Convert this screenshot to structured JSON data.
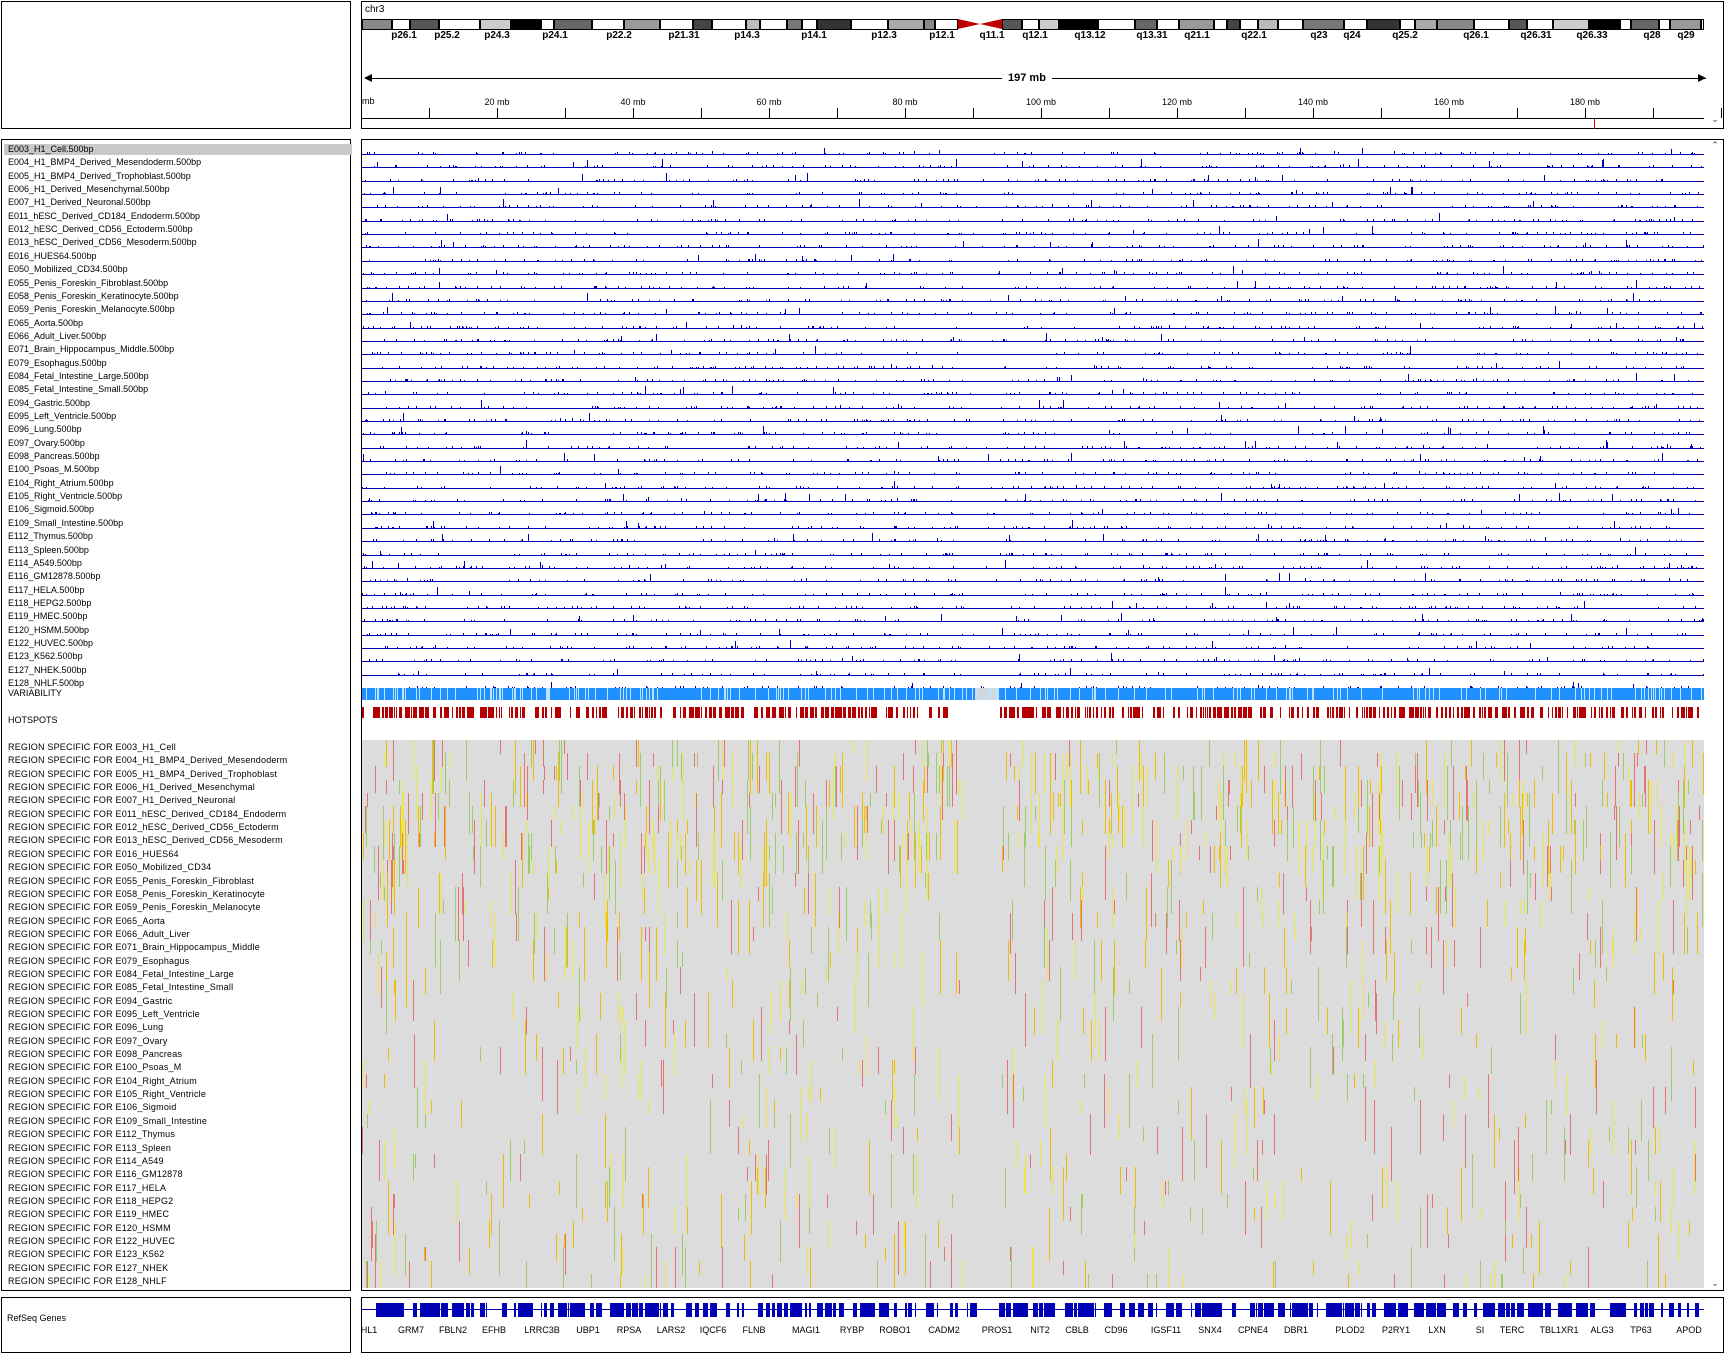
{
  "chromosome": "chr3",
  "span_label": "197 mb",
  "ruler_start_label": "mb",
  "ruler_labels": [
    "20 mb",
    "40 mb",
    "60 mb",
    "80 mb",
    "100 mb",
    "120 mb",
    "140 mb",
    "160 mb",
    "180 mb"
  ],
  "cytobands": [
    "p26.1",
    "p25.2",
    "p24.3",
    "p24.1",
    "p22.2",
    "p21.31",
    "p14.3",
    "p14.1",
    "p12.3",
    "p12.1",
    "q11.1",
    "q12.1",
    "q13.12",
    "q13.31",
    "q21.1",
    "q22.1",
    "q23",
    "q24",
    "q25.2",
    "q26.1",
    "q26.31",
    "q26.33",
    "q28",
    "q29"
  ],
  "tracks": [
    "E003_H1_Cell.500bp",
    "E004_H1_BMP4_Derived_Mesendoderm.500bp",
    "E005_H1_BMP4_Derived_Trophoblast.500bp",
    "E006_H1_Derived_Mesenchymal.500bp",
    "E007_H1_Derived_Neuronal.500bp",
    "E011_hESC_Derived_CD184_Endoderm.500bp",
    "E012_hESC_Derived_CD56_Ectoderm.500bp",
    "E013_hESC_Derived_CD56_Mesoderm.500bp",
    "E016_HUES64.500bp",
    "E050_Mobilized_CD34.500bp",
    "E055_Penis_Foreskin_Fibroblast.500bp",
    "E058_Penis_Foreskin_Keratinocyte.500bp",
    "E059_Penis_Foreskin_Melanocyte.500bp",
    "E065_Aorta.500bp",
    "E066_Adult_Liver.500bp",
    "E071_Brain_Hippocampus_Middle.500bp",
    "E079_Esophagus.500bp",
    "E084_Fetal_Intestine_Large.500bp",
    "E085_Fetal_Intestine_Small.500bp",
    "E094_Gastric.500bp",
    "E095_Left_Ventricle.500bp",
    "E096_Lung.500bp",
    "E097_Ovary.500bp",
    "E098_Pancreas.500bp",
    "E100_Psoas_M.500bp",
    "E104_Right_Atrium.500bp",
    "E105_Right_Ventricle.500bp",
    "E106_Sigmoid.500bp",
    "E109_Small_Intestine.500bp",
    "E112_Thymus.500bp",
    "E113_Spleen.500bp",
    "E114_A549.500bp",
    "E116_GM12878.500bp",
    "E117_HELA.500bp",
    "E118_HEPG2.500bp",
    "E119_HMEC.500bp",
    "E120_HSMM.500bp",
    "E122_HUVEC.500bp",
    "E123_K562.500bp",
    "E127_NHEK.500bp",
    "E128_NHLF.500bp"
  ],
  "variability_label": "VARIABILITY",
  "hotspots_label": "HOTSPOTS",
  "region_specific": [
    "REGION SPECIFIC FOR E003_H1_Cell",
    "REGION SPECIFIC FOR E004_H1_BMP4_Derived_Mesendoderm",
    "REGION SPECIFIC FOR E005_H1_BMP4_Derived_Trophoblast",
    "REGION SPECIFIC FOR E006_H1_Derived_Mesenchymal",
    "REGION SPECIFIC FOR E007_H1_Derived_Neuronal",
    "REGION SPECIFIC FOR E011_hESC_Derived_CD184_Endoderm",
    "REGION SPECIFIC FOR E012_hESC_Derived_CD56_Ectoderm",
    "REGION SPECIFIC FOR E013_hESC_Derived_CD56_Mesoderm",
    "REGION SPECIFIC FOR E016_HUES64",
    "REGION SPECIFIC FOR E050_Mobilized_CD34",
    "REGION SPECIFIC FOR E055_Penis_Foreskin_Fibroblast",
    "REGION SPECIFIC FOR E058_Penis_Foreskin_Keratinocyte",
    "REGION SPECIFIC FOR E059_Penis_Foreskin_Melanocyte",
    "REGION SPECIFIC FOR E065_Aorta",
    "REGION SPECIFIC FOR E066_Adult_Liver",
    "REGION SPECIFIC FOR E071_Brain_Hippocampus_Middle",
    "REGION SPECIFIC FOR E079_Esophagus",
    "REGION SPECIFIC FOR E084_Fetal_Intestine_Large",
    "REGION SPECIFIC FOR E085_Fetal_Intestine_Small",
    "REGION SPECIFIC FOR E094_Gastric",
    "REGION SPECIFIC FOR E095_Left_Ventricle",
    "REGION SPECIFIC FOR E096_Lung",
    "REGION SPECIFIC FOR E097_Ovary",
    "REGION SPECIFIC FOR E098_Pancreas",
    "REGION SPECIFIC FOR E100_Psoas_M",
    "REGION SPECIFIC FOR E104_Right_Atrium",
    "REGION SPECIFIC FOR E105_Right_Ventricle",
    "REGION SPECIFIC FOR E106_Sigmoid",
    "REGION SPECIFIC FOR E109_Small_Intestine",
    "REGION SPECIFIC FOR E112_Thymus",
    "REGION SPECIFIC FOR E113_Spleen",
    "REGION SPECIFIC FOR E114_A549",
    "REGION SPECIFIC FOR E116_GM12878",
    "REGION SPECIFIC FOR E117_HELA",
    "REGION SPECIFIC FOR E118_HEPG2",
    "REGION SPECIFIC FOR E119_HMEC",
    "REGION SPECIFIC FOR E120_HSMM",
    "REGION SPECIFIC FOR E122_HUVEC",
    "REGION SPECIFIC FOR E123_K562",
    "REGION SPECIFIC FOR E127_NHEK",
    "REGION SPECIFIC FOR E128_NHLF"
  ],
  "genes_label": "RefSeq Genes",
  "genes": [
    "HL1",
    "GRM7",
    "FBLN2",
    "EFHB",
    "LRRC3B",
    "UBP1",
    "RPSA",
    "LARS2",
    "IQCF6",
    "FLNB",
    "MAGI1",
    "RYBP",
    "ROBO1",
    "CADM2",
    "PROS1",
    "NIT2",
    "CBLB",
    "CD96",
    "IGSF11",
    "SNX4",
    "CPNE4",
    "DBR1",
    "PLOD2",
    "P2RY1",
    "LXN",
    "SI",
    "TERC",
    "TBL1XR1",
    "ALG3",
    "TP63",
    "APOD"
  ],
  "colors": {
    "signal": "#0000b4",
    "variability": "#1e90ff",
    "hotspot": "#b40000",
    "region_bg": "#dcdcdc",
    "region_marks": [
      "#e8e84a",
      "#9ccc65",
      "#e57373",
      "#f0c000"
    ],
    "centromere": "#c00000"
  },
  "icons": [
    "scroll-up-icon",
    "scroll-down-icon",
    "ruler-arrow-left-icon",
    "ruler-arrow-right-icon"
  ]
}
